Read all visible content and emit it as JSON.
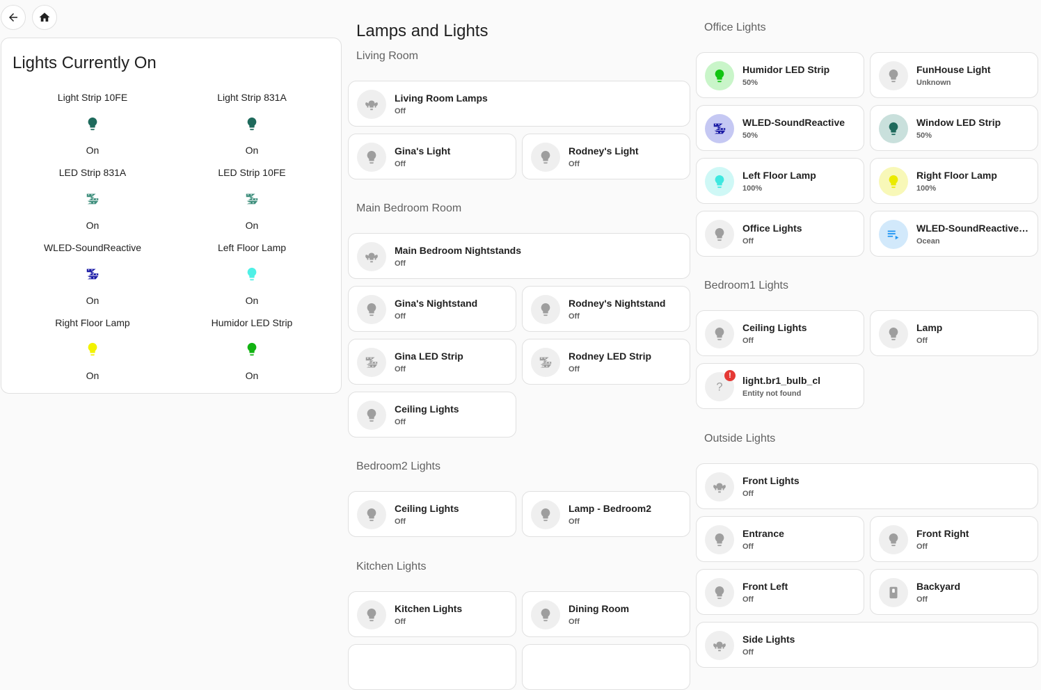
{
  "nav": {
    "back_icon": "arrow-left-icon",
    "home_icon": "home-icon"
  },
  "lights_on": {
    "title": "Lights Currently On",
    "items": [
      {
        "name": "Light Strip 10FE",
        "state": "On",
        "icon": "bulb-icon",
        "color": "#1e6a5c"
      },
      {
        "name": "Light Strip 831A",
        "state": "On",
        "icon": "bulb-icon",
        "color": "#1e6a5c"
      },
      {
        "name": "LED Strip 831A",
        "state": "On",
        "icon": "led-strip-icon",
        "color": "#3f8f7d"
      },
      {
        "name": "LED Strip 10FE",
        "state": "On",
        "icon": "led-strip-icon",
        "color": "#3f8f7d"
      },
      {
        "name": "WLED-SoundReactive",
        "state": "On",
        "icon": "led-strip-icon",
        "color": "#1a1aa6"
      },
      {
        "name": "Left Floor Lamp",
        "state": "On",
        "icon": "bulb-icon",
        "color": "#4ff0e6"
      },
      {
        "name": "Right Floor Lamp",
        "state": "On",
        "icon": "bulb-icon",
        "color": "#f2f200"
      },
      {
        "name": "Humidor LED Strip",
        "state": "On",
        "icon": "bulb-icon",
        "color": "#12b312"
      }
    ]
  },
  "main": {
    "title": "Lamps and Lights",
    "sections": [
      {
        "heading": "Living Room",
        "tiles": [
          {
            "name": "Living Room Lamps",
            "state": "Off",
            "icon": "lamps-icon"
          },
          {
            "name": "Gina's Light",
            "state": "Off",
            "icon": "bulb-icon"
          },
          {
            "name": "Rodney's Light",
            "state": "Off",
            "icon": "bulb-icon"
          }
        ]
      },
      {
        "heading": "Main Bedroom Room",
        "tiles": [
          {
            "name": "Main Bedroom Nightstands",
            "state": "Off",
            "icon": "lamps-icon"
          },
          {
            "name": "Gina's Nightstand",
            "state": "Off",
            "icon": "bulb-icon"
          },
          {
            "name": "Rodney's Nightstand",
            "state": "Off",
            "icon": "bulb-icon"
          },
          {
            "name": "Gina LED Strip",
            "state": "Off",
            "icon": "led-strip-icon"
          },
          {
            "name": "Rodney LED Strip",
            "state": "Off",
            "icon": "led-strip-icon"
          },
          {
            "name": "Ceiling Lights",
            "state": "Off",
            "icon": "bulb-icon"
          }
        ]
      },
      {
        "heading": "Bedroom2 Lights",
        "tiles": [
          {
            "name": "Ceiling Lights",
            "state": "Off",
            "icon": "bulb-icon"
          },
          {
            "name": "Lamp - Bedroom2",
            "state": "Off",
            "icon": "bulb-icon"
          }
        ]
      },
      {
        "heading": "Kitchen Lights",
        "tiles": [
          {
            "name": "Kitchen Lights",
            "state": "Off",
            "icon": "bulb-icon"
          },
          {
            "name": "Dining Room",
            "state": "Off",
            "icon": "bulb-icon"
          }
        ]
      }
    ]
  },
  "right": {
    "sections": [
      {
        "heading": "Office Lights",
        "tiles": [
          {
            "name": "Humidor LED Strip",
            "state": "50%",
            "icon": "bulb-icon",
            "color": "#12c412",
            "bg": "#c9f5c9"
          },
          {
            "name": "FunHouse Light",
            "state": "Unknown",
            "icon": "bulb-icon"
          },
          {
            "name": "WLED-SoundReactive",
            "state": "50%",
            "icon": "led-strip-icon",
            "color": "#1a1aa6",
            "bg": "#c5c8f3"
          },
          {
            "name": "Window LED Strip",
            "state": "50%",
            "icon": "bulb-icon",
            "color": "#1e6a5c",
            "bg": "#c9e0dc"
          },
          {
            "name": "Left Floor Lamp",
            "state": "100%",
            "icon": "bulb-icon",
            "color": "#3ee8e0",
            "bg": "#cff8f6"
          },
          {
            "name": "Right Floor Lamp",
            "state": "100%",
            "icon": "bulb-icon",
            "color": "#eaea00",
            "bg": "#f8f8b8"
          },
          {
            "name": "Office Lights",
            "state": "Off",
            "icon": "bulb-icon"
          },
          {
            "name": "WLED-SoundReactive P...",
            "state": "Ocean",
            "icon": "playlist-icon",
            "color": "#2196f3",
            "bg": "#d2e9fb"
          }
        ]
      },
      {
        "heading": "Bedroom1 Lights",
        "tiles": [
          {
            "name": "Ceiling Lights",
            "state": "Off",
            "icon": "bulb-icon"
          },
          {
            "name": "Lamp",
            "state": "Off",
            "icon": "bulb-icon"
          },
          {
            "name": "light.br1_bulb_cl",
            "state": "Entity not found",
            "icon": "question-icon",
            "badge": "!"
          }
        ]
      },
      {
        "heading": "Outside Lights",
        "tiles": [
          {
            "name": "Front Lights",
            "state": "Off",
            "icon": "lamps-icon"
          },
          {
            "name": "Entrance",
            "state": "Off",
            "icon": "bulb-icon"
          },
          {
            "name": "Front Right",
            "state": "Off",
            "icon": "bulb-icon"
          },
          {
            "name": "Front Left",
            "state": "Off",
            "icon": "bulb-icon"
          },
          {
            "name": "Backyard",
            "state": "Off",
            "icon": "switch-icon"
          },
          {
            "name": "Side Lights",
            "state": "Off",
            "icon": "lamps-icon"
          }
        ]
      }
    ]
  }
}
